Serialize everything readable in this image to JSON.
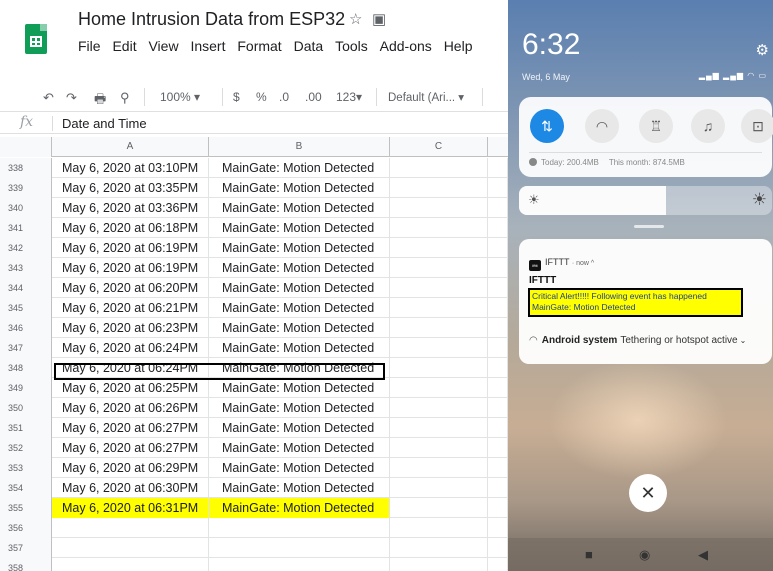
{
  "sheets": {
    "title": "Home Intrusion Data from ESP32",
    "menu": [
      "File",
      "Edit",
      "View",
      "Insert",
      "Format",
      "Data",
      "Tools",
      "Add-ons",
      "Help"
    ],
    "toolbar": {
      "zoom": "100%",
      "currency": "$",
      "percent": "%",
      "decrease_decimal": ".0",
      "increase_decimal": ".00",
      "more_formats": "123",
      "font": "Default (Ari..."
    },
    "formula_bar": {
      "fx": "fx",
      "value": "Date and Time"
    },
    "columns": [
      "A",
      "B",
      "C"
    ],
    "rows": [
      {
        "num": "338",
        "a": "May 6, 2020 at 03:10PM",
        "b": "MainGate: Motion Detected"
      },
      {
        "num": "339",
        "a": "May 6, 2020 at 03:35PM",
        "b": "MainGate: Motion Detected"
      },
      {
        "num": "340",
        "a": "May 6, 2020 at 03:36PM",
        "b": "MainGate: Motion Detected"
      },
      {
        "num": "341",
        "a": "May 6, 2020 at 06:18PM",
        "b": "MainGate: Motion Detected"
      },
      {
        "num": "342",
        "a": "May 6, 2020 at 06:19PM",
        "b": "MainGate: Motion Detected"
      },
      {
        "num": "343",
        "a": "May 6, 2020 at 06:19PM",
        "b": "MainGate: Motion Detected"
      },
      {
        "num": "344",
        "a": "May 6, 2020 at 06:20PM",
        "b": "MainGate: Motion Detected"
      },
      {
        "num": "345",
        "a": "May 6, 2020 at 06:21PM",
        "b": "MainGate: Motion Detected"
      },
      {
        "num": "346",
        "a": "May 6, 2020 at 06:23PM",
        "b": "MainGate: Motion Detected"
      },
      {
        "num": "347",
        "a": "May 6, 2020 at 06:24PM",
        "b": "MainGate: Motion Detected"
      },
      {
        "num": "348",
        "a": "May 6, 2020 at 06:24PM",
        "b": "MainGate: Motion Detected"
      },
      {
        "num": "349",
        "a": "May 6, 2020 at 06:25PM",
        "b": "MainGate: Motion Detected"
      },
      {
        "num": "350",
        "a": "May 6, 2020 at 06:26PM",
        "b": "MainGate: Motion Detected"
      },
      {
        "num": "351",
        "a": "May 6, 2020 at 06:27PM",
        "b": "MainGate: Motion Detected"
      },
      {
        "num": "352",
        "a": "May 6, 2020 at 06:27PM",
        "b": "MainGate: Motion Detected"
      },
      {
        "num": "353",
        "a": "May 6, 2020 at 06:29PM",
        "b": "MainGate: Motion Detected"
      },
      {
        "num": "354",
        "a": "May 6, 2020 at 06:30PM",
        "b": "MainGate: Motion Detected"
      },
      {
        "num": "355",
        "a": "May 6, 2020 at 06:31PM",
        "b": "MainGate: Motion Detected",
        "highlighted": true
      },
      {
        "num": "356",
        "a": "",
        "b": ""
      },
      {
        "num": "357",
        "a": "",
        "b": ""
      },
      {
        "num": "358",
        "a": "",
        "b": ""
      }
    ],
    "highlight_color": "#ffff00",
    "brand_color": "#0f9d58"
  },
  "android": {
    "time": "6:32",
    "date": "Wed, 6 May",
    "data_usage": {
      "today": "Today: 200.4MB",
      "month": "This month: 874.5MB"
    },
    "brightness_level": 0.58,
    "notification": {
      "app": "IFTTT",
      "meta": "· now ^",
      "title": "IFTTT",
      "line1": "Critical Alert!!!!! Following event has happened",
      "line2": "MainGate: Motion Detected"
    },
    "system_notification": {
      "app": "Android system",
      "text": "Tethering or hotspot active"
    },
    "accent_color": "#1e88e5"
  }
}
